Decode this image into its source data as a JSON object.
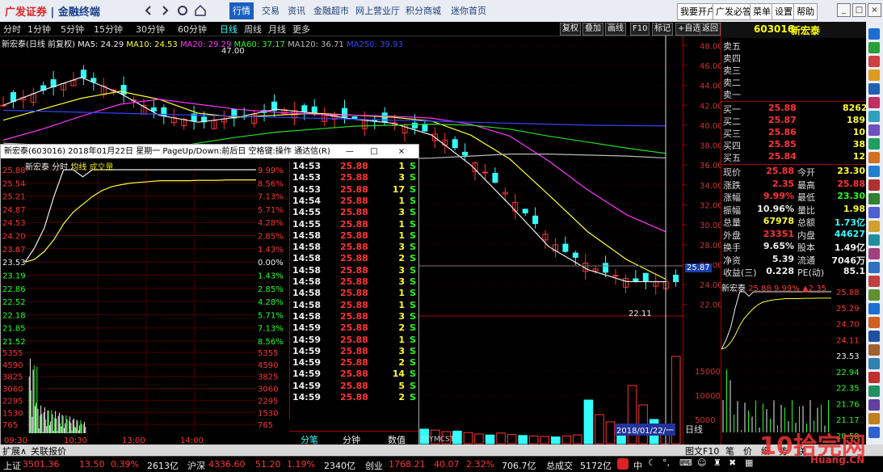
{
  "topbar": {
    "logo_brand": "广发证券",
    "logo_product": "金融终端",
    "menu": [
      "行情",
      "交易",
      "资讯",
      "金融超市",
      "网上营业厅",
      "积分商城",
      "迷你首页"
    ],
    "active_menu": "行情",
    "right_buttons": [
      "我要开户",
      "广发必答",
      "菜单",
      "设置",
      "帮助"
    ]
  },
  "timeframes": {
    "items": [
      "分时",
      "1分钟",
      "5分钟",
      "15分钟",
      "30分钟",
      "60分钟",
      "日线",
      "周线",
      "月线",
      "更多"
    ],
    "active": "日线",
    "right_tools": [
      "复权",
      "叠加",
      "画线",
      "F10",
      "标记",
      "+自选",
      "返回"
    ]
  },
  "kline_legend": {
    "title": "新宏泰(日线 前复权)",
    "ma5": "MA5: 24.29",
    "ma10": "MA10: 24.53",
    "ma20": "MA20: 29.29",
    "ma60": "MA60: 37.17",
    "ma120": "MA120: 36.71",
    "ma250": "MA250: 39.93",
    "high_label": "47.00",
    "low_label": "22.11",
    "last_price_tag": "25.87",
    "date_tag": "2018/01/22/一",
    "x_tabs": [
      "PSY",
      "MCST"
    ],
    "day_tab": "日线"
  },
  "chart_data": [
    {
      "type": "line",
      "title": "新宏泰(日线 前复权)",
      "xlabel": "",
      "ylabel": "",
      "ylim": [
        21,
        49
      ],
      "yticks": [
        22.0,
        24.0,
        26.0,
        28.0,
        30.0,
        32.0,
        34.0,
        36.0,
        38.0,
        40.0,
        42.0,
        44.0,
        46.0,
        48.0
      ],
      "series": [
        {
          "name": "MA5",
          "values": [
            42.0,
            43.5,
            44.8,
            43.2,
            41.0,
            40.3,
            40.8,
            41.6,
            41.2,
            40.6,
            40.2,
            39.0,
            36.0,
            32.0,
            27.8,
            25.5,
            24.3,
            24.29
          ],
          "color": "#eeeeee"
        },
        {
          "name": "MA10",
          "values": [
            40.5,
            41.6,
            42.7,
            43.4,
            42.6,
            41.2,
            40.8,
            41.0,
            41.2,
            41.0,
            40.8,
            40.4,
            39.0,
            36.6,
            33.0,
            29.3,
            26.5,
            24.53
          ],
          "color": "#ffff33"
        },
        {
          "name": "MA20",
          "values": [
            38.5,
            39.6,
            40.9,
            42.1,
            42.6,
            42.1,
            41.6,
            41.3,
            41.1,
            41.0,
            40.9,
            40.7,
            40.1,
            38.9,
            36.4,
            33.5,
            31.0,
            29.29
          ],
          "color": "#ff33ff"
        },
        {
          "name": "MA60",
          "values": [
            34.5,
            35.0,
            35.8,
            36.7,
            37.5,
            38.2,
            38.8,
            39.3,
            39.6,
            39.9,
            40.0,
            40.1,
            40.0,
            39.6,
            38.9,
            38.3,
            37.7,
            37.17
          ],
          "color": "#22dd22"
        },
        {
          "name": "MA120",
          "values": [
            38.2,
            38.0,
            37.7,
            37.4,
            37.1,
            36.8,
            36.7,
            36.6,
            36.6,
            36.6,
            36.6,
            36.7,
            36.9,
            37.1,
            37.1,
            37.0,
            36.9,
            36.71
          ],
          "color": "#bbbbbb"
        },
        {
          "name": "MA250",
          "values": [
            41.5,
            41.4,
            41.3,
            41.2,
            41.1,
            41.0,
            40.9,
            40.8,
            40.7,
            40.6,
            40.5,
            40.4,
            40.3,
            40.2,
            40.1,
            40.0,
            39.96,
            39.93
          ],
          "color": "#3344ff"
        }
      ]
    },
    {
      "type": "bar",
      "title": "",
      "ylim": [
        0,
        20000
      ],
      "yticks": [
        5000,
        10000,
        15000
      ],
      "unit_label": "X10",
      "values": [
        3000,
        2800,
        2500,
        2600,
        2300,
        2000,
        1800,
        2200,
        1900,
        1700,
        1600,
        1500,
        1400,
        1600,
        1800,
        9000,
        6000,
        4500,
        3500,
        12000,
        8000,
        5000,
        2500,
        18000
      ]
    },
    {
      "type": "line",
      "title": "新宏泰 分时",
      "ylim": [
        19.18,
        25.88
      ],
      "price_ticks": [
        25.88,
        25.54,
        25.21,
        24.87,
        24.53,
        24.2,
        23.87,
        23.53,
        23.19,
        22.86,
        22.52,
        22.18,
        21.85,
        21.52
      ],
      "pct_ticks": [
        "9.99%",
        "8.56%",
        "7.13%",
        "5.71%",
        "4.28%",
        "2.85%",
        "1.43%",
        "0.00%",
        "1.43%",
        "2.85%",
        "4.28%",
        "5.71%",
        "7.13%",
        "8.56%"
      ],
      "vol_ticks": [
        5355,
        4590,
        3825,
        3060,
        2295,
        1530,
        765
      ],
      "x_ticks": [
        "09:30",
        "10:30",
        "13:00",
        "14:00"
      ],
      "series": [
        {
          "name": "分时",
          "values": [
            23.53,
            23.9,
            24.4,
            25.2,
            25.88,
            25.88,
            25.7,
            25.88,
            25.88,
            25.88,
            25.88,
            25.88,
            25.88,
            25.88,
            25.88,
            25.88,
            25.88,
            25.88,
            25.88,
            25.88,
            25.88,
            25.88,
            25.88,
            25.88,
            25.88
          ]
        },
        {
          "name": "均线",
          "values": [
            23.53,
            23.6,
            23.8,
            24.1,
            24.5,
            24.8,
            25.0,
            25.2,
            25.35,
            25.45,
            25.5,
            25.54,
            25.56,
            25.58,
            25.6,
            25.6,
            25.6,
            25.6,
            25.61,
            25.61,
            25.61,
            25.62,
            25.62,
            25.62,
            25.62
          ]
        }
      ]
    }
  ],
  "popup": {
    "title": "新宏泰(603016) 2018年01月22日 星期一 PageUp/Down:前后日 空格键:操作 通达信(R)",
    "header": [
      "新宏泰",
      "分时",
      "均线",
      "成交量"
    ],
    "left_prices": [
      "25.88",
      "25.54",
      "25.21",
      "24.87",
      "24.53",
      "24.20",
      "23.87",
      "23.53",
      "23.19",
      "22.86",
      "22.52",
      "22.18",
      "21.85",
      "21.52"
    ],
    "right_pcts": [
      "9.99%",
      "8.56%",
      "7.13%",
      "5.71%",
      "4.28%",
      "2.85%",
      "1.43%",
      "0.00%",
      "1.43%",
      "2.85%",
      "4.28%",
      "5.71%",
      "7.13%",
      "8.56%"
    ],
    "vol_left": [
      "5355",
      "4590",
      "3825",
      "3060",
      "2295",
      "1530",
      "765"
    ],
    "x_ticks": [
      "09:30",
      "10:30",
      "13:00",
      "14:00"
    ],
    "ticks": [
      [
        "14:53",
        "25.88",
        "1",
        "S"
      ],
      [
        "14:53",
        "25.88",
        "3",
        "S"
      ],
      [
        "14:53",
        "25.88",
        "17",
        "S"
      ],
      [
        "14:54",
        "25.88",
        "1",
        "S"
      ],
      [
        "14:55",
        "25.88",
        "3",
        "S"
      ],
      [
        "14:55",
        "25.88",
        "1",
        "S"
      ],
      [
        "14:58",
        "25.88",
        "1",
        "S"
      ],
      [
        "14:58",
        "25.88",
        "3",
        "S"
      ],
      [
        "14:58",
        "25.88",
        "2",
        "S"
      ],
      [
        "14:58",
        "25.88",
        "3",
        "S"
      ],
      [
        "14:58",
        "25.88",
        "3",
        "S"
      ],
      [
        "14:58",
        "25.88",
        "1",
        "S"
      ],
      [
        "14:58",
        "25.88",
        "1",
        "S"
      ],
      [
        "14:58",
        "25.88",
        "3",
        "S"
      ],
      [
        "14:59",
        "25.88",
        "2",
        "S"
      ],
      [
        "14:59",
        "25.88",
        "1",
        "S"
      ],
      [
        "14:59",
        "25.88",
        "3",
        "S"
      ],
      [
        "14:59",
        "25.88",
        "2",
        "S"
      ],
      [
        "14:59",
        "25.88",
        "14",
        "S"
      ],
      [
        "14:59",
        "25.88",
        "5",
        "S"
      ],
      [
        "14:59",
        "25.88",
        "2",
        "S"
      ]
    ],
    "bottom_tabs": [
      "分笔",
      "分钟",
      "数值"
    ]
  },
  "quote": {
    "code": "603016",
    "name": "新宏泰",
    "sell": [
      {
        "label": "卖五",
        "price": "",
        "vol": ""
      },
      {
        "label": "卖四",
        "price": "",
        "vol": ""
      },
      {
        "label": "卖三",
        "price": "",
        "vol": ""
      },
      {
        "label": "卖二",
        "price": "",
        "vol": ""
      },
      {
        "label": "卖一",
        "price": "",
        "vol": ""
      }
    ],
    "buy": [
      {
        "label": "买一",
        "price": "25.88",
        "vol": "8262"
      },
      {
        "label": "买二",
        "price": "25.87",
        "vol": "189"
      },
      {
        "label": "买三",
        "price": "25.86",
        "vol": "10"
      },
      {
        "label": "买四",
        "price": "25.85",
        "vol": "38"
      },
      {
        "label": "买五",
        "price": "25.84",
        "vol": "12"
      }
    ],
    "stats": [
      [
        "现价",
        "25.88",
        "今开",
        "23.30"
      ],
      [
        "涨跌",
        "2.35",
        "最高",
        "25.88"
      ],
      [
        "涨幅",
        "9.99%",
        "最低",
        "23.30"
      ],
      [
        "振幅",
        "10.96%",
        "量比",
        "1.98"
      ],
      [
        "总量",
        "67978",
        "总额",
        "1.73亿"
      ],
      [
        "外盘",
        "23351",
        "内盘",
        "44627"
      ],
      [
        "换手",
        "9.65%",
        "股本",
        "1.49亿"
      ],
      [
        "净资",
        "5.39",
        "流通",
        "7046万"
      ],
      [
        "收益(三)",
        "0.228",
        "PE(动)",
        "85.1"
      ]
    ],
    "mini_title": "新宏泰",
    "mini_price": "25.88",
    "mini_pct": "9.99%",
    "mini_change": "▲2.35",
    "mini_ticks": [
      "25.88",
      "25.29",
      "24.70",
      "24.11",
      "23.53",
      "22.94",
      "22.35",
      "21.76",
      "21.17",
      "20.58"
    ],
    "mini_tabs": [
      "笔",
      "价",
      "细",
      "势",
      "联"
    ]
  },
  "bottom_tabs": [
    "扩展∧",
    "关联报价"
  ],
  "status": {
    "sh_label": "上证",
    "sh_index": "3501.36",
    "sh_change": "13.50",
    "sh_pct": "0.39%",
    "sh_amount": "2613亿",
    "hs_label": "沪深",
    "hs_index": "4336.60",
    "hs_change": "51.20",
    "hs_pct": "1.19%",
    "hs_amount": "2340亿",
    "cy_label": "创业",
    "cy_index": "1768.21",
    "cy_change": "40.07",
    "cy_pct": "2.32%",
    "cy_amount": "706.7亿",
    "total_label": "总成交",
    "total_amount": "5172亿",
    "watermark": "10拾完网",
    "watermark_domain": "Huang.CN"
  }
}
